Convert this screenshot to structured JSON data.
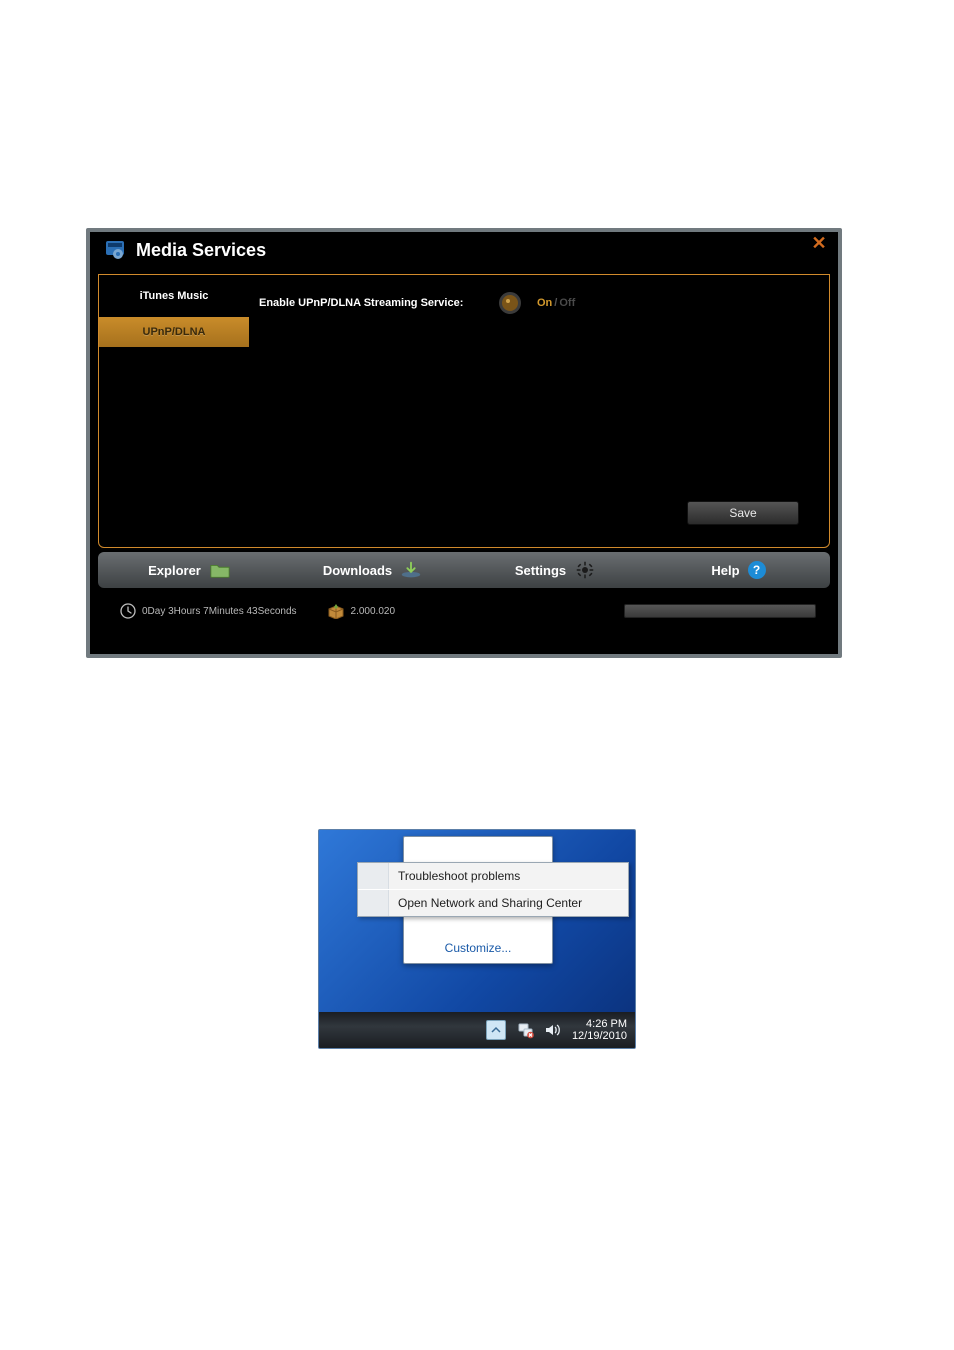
{
  "app": {
    "title": "Media Services",
    "close_icon": "✕",
    "sidebar": {
      "items": [
        {
          "label": "iTunes Music"
        },
        {
          "label": "UPnP/DLNA"
        }
      ],
      "active_index": 1
    },
    "content": {
      "service_label": "Enable UPnP/DLNA Streaming Service:",
      "toggle": {
        "on": "On",
        "off": "Off"
      },
      "save_label": "Save"
    },
    "navbar": {
      "explorer": "Explorer",
      "downloads": "Downloads",
      "settings": "Settings",
      "help": "Help"
    },
    "statusbar": {
      "uptime": "0Day 3Hours 7Minutes 43Seconds",
      "version": "2.000.020"
    }
  },
  "win": {
    "menu": {
      "troubleshoot": "Troubleshoot problems",
      "open_network": "Open Network and Sharing Center"
    },
    "tooltip": {
      "customize": "Customize..."
    },
    "clock": {
      "time": "4:26 PM",
      "date": "12/19/2010"
    }
  }
}
